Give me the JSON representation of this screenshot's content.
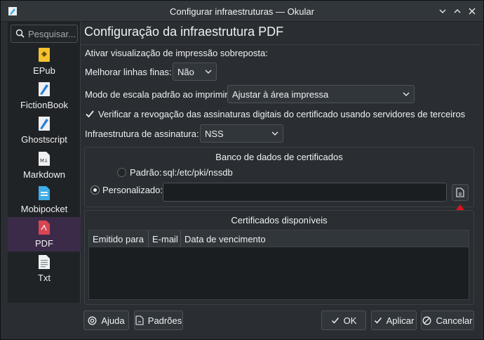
{
  "window": {
    "title": "Configurar infraestruturas — Okular"
  },
  "sidebar": {
    "search_placeholder": "Pesquisar...",
    "items": [
      {
        "label": "EPub",
        "icon": "epub-icon"
      },
      {
        "label": "FictionBook",
        "icon": "fictionbook-icon"
      },
      {
        "label": "Ghostscript",
        "icon": "ghostscript-icon"
      },
      {
        "label": "Markdown",
        "icon": "markdown-icon"
      },
      {
        "label": "Mobipocket",
        "icon": "mobipocket-icon"
      },
      {
        "label": "PDF",
        "icon": "pdf-icon",
        "selected": true
      },
      {
        "label": "Txt",
        "icon": "txt-icon"
      }
    ]
  },
  "main": {
    "heading": "Configuração da infraestrutura PDF",
    "overprint_label": "Ativar visualização de impressão sobreposta:",
    "thin_lines_label": "Melhorar linhas finas:",
    "thin_lines_value": "Não",
    "scale_label": "Modo de escala padrão ao imprimir:",
    "scale_value": "Ajustar à área impressa",
    "verify_revocation_label": "Verificar a revogação das assinaturas digitais do certificado usando servidores de terceiros",
    "verify_revocation_checked": true,
    "signature_backend_label": "Infraestrutura de assinatura:",
    "signature_backend_value": "NSS"
  },
  "cert_db": {
    "title": "Banco de dados de certificados",
    "default_label": "Padrão:",
    "default_path": "sql:/etc/pki/nssdb",
    "custom_label": "Personalizado:",
    "custom_value": "",
    "selected": "custom"
  },
  "certs": {
    "title": "Certificados disponíveis",
    "columns": [
      "Emitido para",
      "E-mail",
      "Data de vencimento"
    ],
    "rows": []
  },
  "buttons": {
    "help": "Ajuda",
    "defaults": "Padrões",
    "ok": "OK",
    "apply": "Aplicar",
    "cancel": "Cancelar"
  },
  "colors": {
    "accent": "#3daee9",
    "selection": "#3b2b49",
    "annotation_arrow": "#e0111a"
  }
}
